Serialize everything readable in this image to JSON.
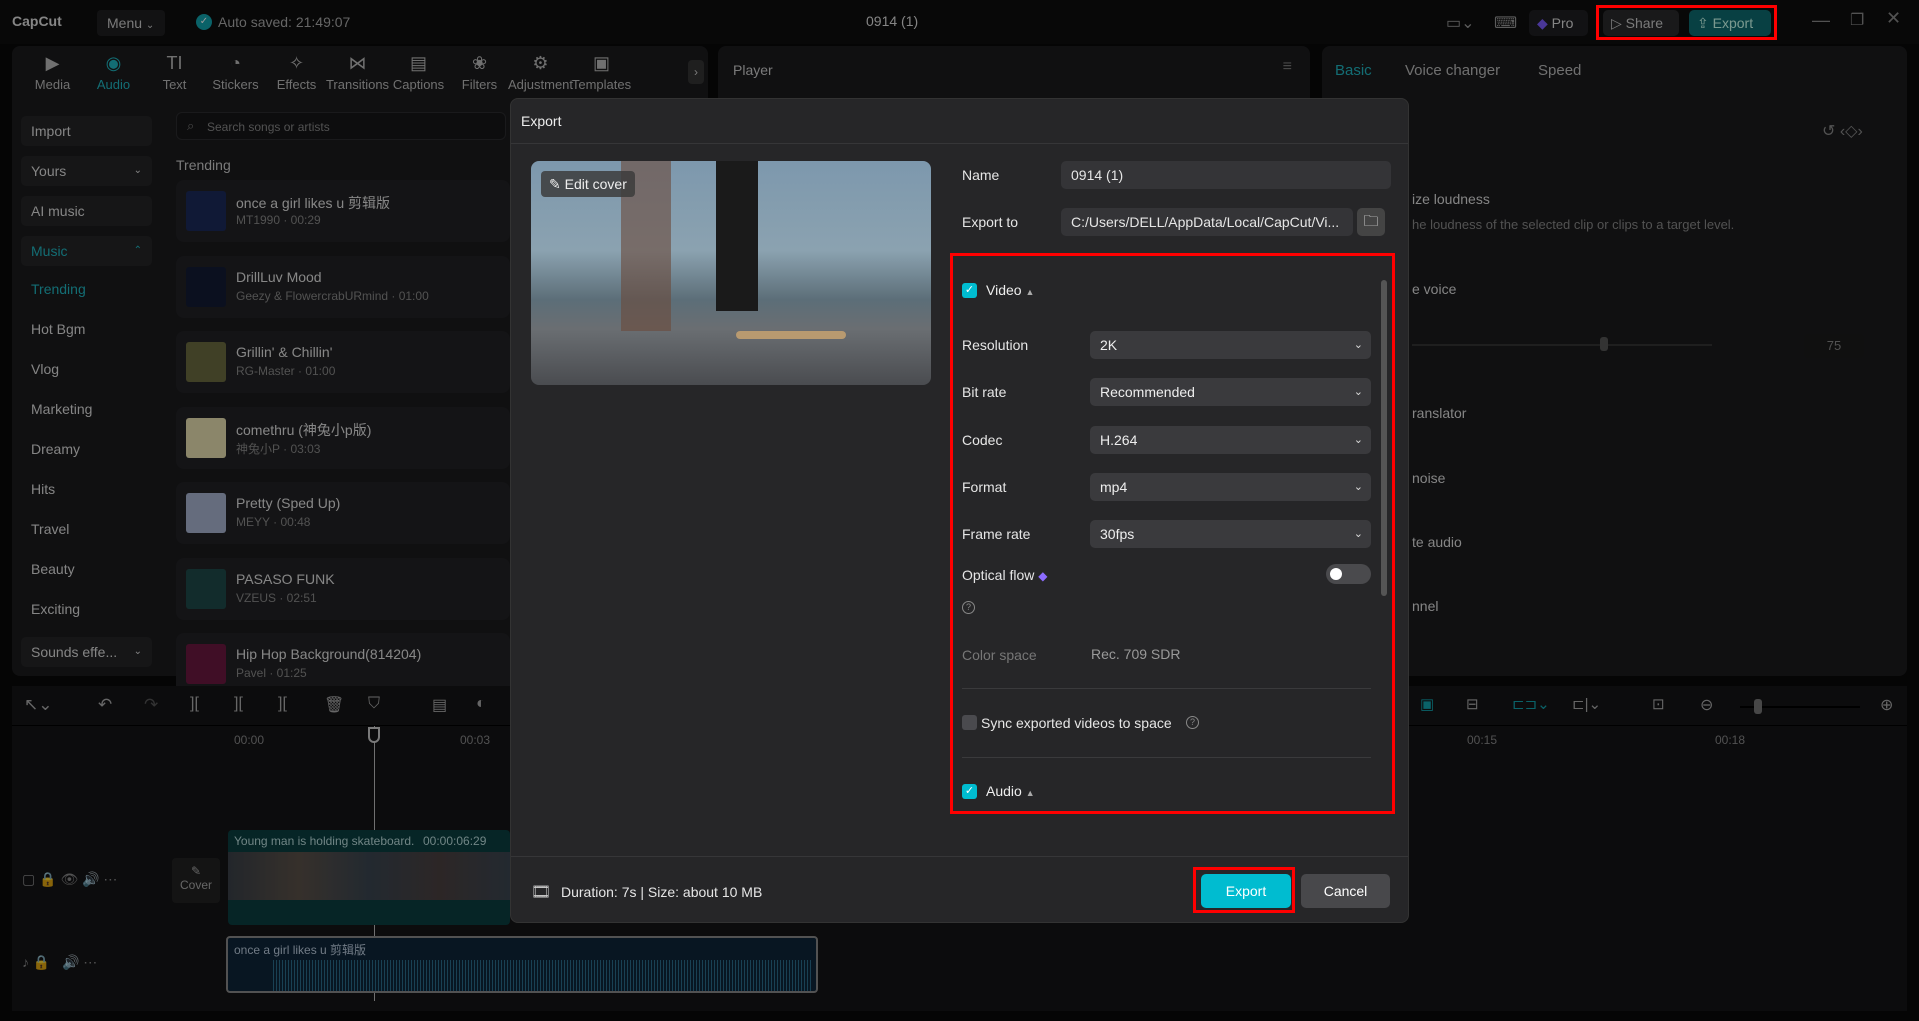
{
  "app": {
    "logo": "CapCut",
    "menu": "Menu",
    "autosave": "Auto saved: 21:49:07",
    "project_title": "0914 (1)",
    "pro": "Pro",
    "share": "Share",
    "export": "Export"
  },
  "toolbar_tabs": [
    {
      "label": "Media",
      "icon": "media-icon"
    },
    {
      "label": "Audio",
      "icon": "audio-icon"
    },
    {
      "label": "Text",
      "icon": "text-icon"
    },
    {
      "label": "Stickers",
      "icon": "stickers-icon"
    },
    {
      "label": "Effects",
      "icon": "effects-icon"
    },
    {
      "label": "Transitions",
      "icon": "transitions-icon"
    },
    {
      "label": "Captions",
      "icon": "captions-icon"
    },
    {
      "label": "Filters",
      "icon": "filters-icon"
    },
    {
      "label": "Adjustment",
      "icon": "adjustment-icon"
    },
    {
      "label": "Templates",
      "icon": "templates-icon"
    }
  ],
  "sidebar": {
    "import": "Import",
    "yours": "Yours",
    "ai_music": "AI music",
    "music": "Music",
    "subs": [
      "Trending",
      "Hot Bgm",
      "Vlog",
      "Marketing",
      "Dreamy",
      "Hits",
      "Travel",
      "Beauty",
      "Exciting"
    ],
    "sounds": "Sounds effe..."
  },
  "search": {
    "placeholder": "Search songs or artists"
  },
  "list_heading": "Trending",
  "songs": [
    {
      "title": "once a girl likes u 剪辑版",
      "sub": "MT1990 · 00:29",
      "color": "#1b2a5a"
    },
    {
      "title": "DrillLuv Mood",
      "sub": "Geezy & FlowercrabURmind · 01:00",
      "color": "#121a33"
    },
    {
      "title": "Grillin' & Chillin'",
      "sub": "RG-Master · 01:00",
      "color": "#6a6a40"
    },
    {
      "title": "comethru (神兔小p版)",
      "sub": "神兔小P · 03:03",
      "color": "#e8e0b0"
    },
    {
      "title": "Pretty (Sped Up)",
      "sub": "MEYY · 00:48",
      "color": "#a8b4d0"
    },
    {
      "title": "PASASO FUNK",
      "sub": "VZEUS · 02:51",
      "color": "#1e4a4a"
    },
    {
      "title": "Hip Hop Background(814204)",
      "sub": "Pavel · 01:25",
      "color": "#6a1840"
    }
  ],
  "player": {
    "title": "Player"
  },
  "right_panel": {
    "tabs": [
      "Basic",
      "Voice changer",
      "Speed"
    ],
    "rows": [
      "ize loudness",
      "he loudness of the selected clip or clips to a target level.",
      "e voice",
      "ranslator",
      "noise",
      "te audio",
      "nnel"
    ],
    "slider_value": "75"
  },
  "timeline": {
    "ticks": [
      "00:00",
      "00:03",
      "00:15",
      "00:18"
    ],
    "video_clip_label": "Young man is holding skateboard.",
    "video_clip_duration": "00:00:06:29",
    "cover": "Cover",
    "audio_clip_label": "once a girl likes u 剪辑版"
  },
  "dialog": {
    "title": "Export",
    "edit_cover": "Edit cover",
    "name_label": "Name",
    "name_value": "0914 (1)",
    "export_to_label": "Export to",
    "export_to_value": "C:/Users/DELL/AppData/Local/CapCut/Vi...",
    "video_section": "Video",
    "video_checked": true,
    "settings": [
      {
        "label": "Resolution",
        "value": "2K"
      },
      {
        "label": "Bit rate",
        "value": "Recommended"
      },
      {
        "label": "Codec",
        "value": "H.264"
      },
      {
        "label": "Format",
        "value": "mp4"
      },
      {
        "label": "Frame rate",
        "value": "30fps"
      }
    ],
    "optical_flow": "Optical flow",
    "optical_flow_on": false,
    "color_space_label": "Color space",
    "color_space_value": "Rec. 709 SDR",
    "sync_label": "Sync exported videos to space",
    "sync_checked": false,
    "audio_section": "Audio",
    "audio_checked": true,
    "footer_info": "Duration: 7s | Size: about 10 MB",
    "export_button": "Export",
    "cancel_button": "Cancel"
  },
  "colors": {
    "accent": "#00bcd0",
    "highlight": "#ff0000",
    "pro": "#7b5cff"
  }
}
